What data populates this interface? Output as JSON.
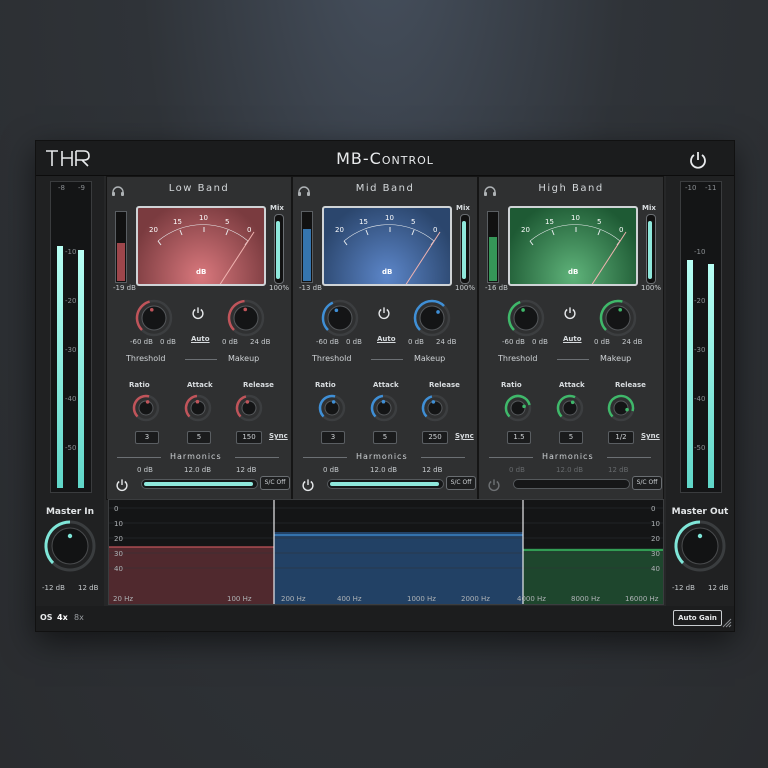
{
  "header": {
    "logo": "THR",
    "title": "MB-Control"
  },
  "colors": {
    "low": "#c0545a",
    "mid": "#3f8fd6",
    "high": "#3fb86a",
    "meter": "#7fe6d8"
  },
  "master_in": {
    "label": "Master In",
    "min": "-12 dB",
    "max": "12 dB",
    "ticks_top": [
      "-8",
      "-9"
    ],
    "scale": [
      "-10",
      "-20",
      "-30",
      "-40",
      "-50"
    ]
  },
  "master_out": {
    "label": "Master Out",
    "min": "-12 dB",
    "max": "12 dB",
    "ticks_top": [
      "-10",
      "-11"
    ],
    "scale": [
      "-10",
      "-20",
      "-30",
      "-40",
      "-50"
    ]
  },
  "bands": [
    {
      "name": "Low Band",
      "vu_unit": "dB",
      "vu_scale": [
        "20",
        "15",
        "10",
        "5",
        "0"
      ],
      "meter_value": "-19 dB",
      "mix": "Mix",
      "mix_value": "100%",
      "threshold": {
        "label": "Threshold",
        "min": "-60 dB",
        "max": "0 dB"
      },
      "auto": "Auto",
      "makeup": {
        "label": "Makeup",
        "min": "0 dB",
        "max": "24 dB"
      },
      "ratio": {
        "label": "Ratio",
        "value": "3"
      },
      "attack": {
        "label": "Attack",
        "value": "5"
      },
      "release": {
        "label": "Release",
        "value": "150"
      },
      "sync": "Sync",
      "harmonics": {
        "label": "Harmonics",
        "min": "0 dB",
        "mid": "12.0 dB",
        "max": "12 dB",
        "sc": "S/C Off"
      }
    },
    {
      "name": "Mid Band",
      "vu_unit": "dB",
      "vu_scale": [
        "20",
        "15",
        "10",
        "5",
        "0"
      ],
      "meter_value": "-13 dB",
      "mix": "Mix",
      "mix_value": "100%",
      "threshold": {
        "label": "Threshold",
        "min": "-60 dB",
        "max": "0 dB"
      },
      "auto": "Auto",
      "makeup": {
        "label": "Makeup",
        "min": "0 dB",
        "max": "24 dB"
      },
      "ratio": {
        "label": "Ratio",
        "value": "3"
      },
      "attack": {
        "label": "Attack",
        "value": "5"
      },
      "release": {
        "label": "Release",
        "value": "250"
      },
      "sync": "Sync",
      "harmonics": {
        "label": "Harmonics",
        "min": "0 dB",
        "mid": "12.0 dB",
        "max": "12 dB",
        "sc": "S/C Off"
      }
    },
    {
      "name": "High Band",
      "vu_unit": "dB",
      "vu_scale": [
        "20",
        "15",
        "10",
        "5",
        "0"
      ],
      "meter_value": "-16 dB",
      "mix": "Mix",
      "mix_value": "100%",
      "threshold": {
        "label": "Threshold",
        "min": "-60 dB",
        "max": "0 dB"
      },
      "auto": "Auto",
      "makeup": {
        "label": "Makeup",
        "min": "0 dB",
        "max": "24 dB"
      },
      "ratio": {
        "label": "Ratio",
        "value": "1.5"
      },
      "attack": {
        "label": "Attack",
        "value": "5"
      },
      "release": {
        "label": "Release",
        "value": "1/2"
      },
      "sync": "Sync",
      "harmonics": {
        "label": "Harmonics",
        "min": "0 dB",
        "mid": "12.0 dB",
        "max": "12 dB",
        "sc": "S/C Off"
      }
    }
  ],
  "analyzer": {
    "db_left": [
      "0",
      "10",
      "20",
      "30",
      "40"
    ],
    "db_right": [
      "0",
      "10",
      "20",
      "30",
      "40"
    ],
    "freq": [
      "20 Hz",
      "100 Hz",
      "200 Hz",
      "400 Hz",
      "1000 Hz",
      "2000 Hz",
      "4000 Hz",
      "8000 Hz",
      "16000 Hz"
    ]
  },
  "footer": {
    "os": "OS",
    "os_4x": "4x",
    "os_8x": "8x",
    "auto_gain": "Auto Gain"
  }
}
